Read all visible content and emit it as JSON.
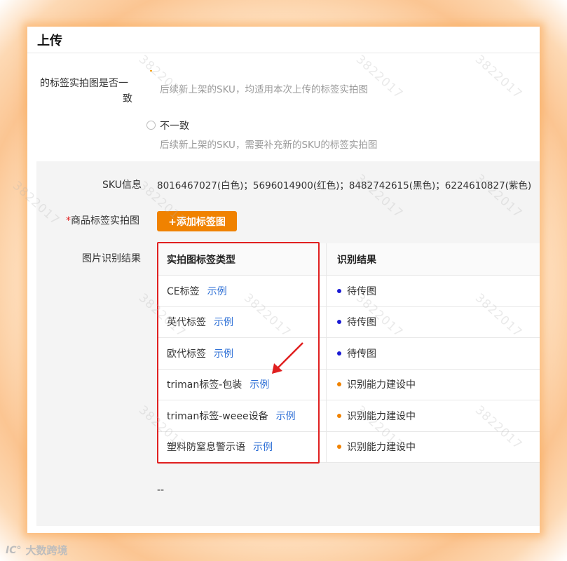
{
  "header": {
    "title": "上传"
  },
  "consistency": {
    "label_line1": "的标签实拍图是否一",
    "label_line2": "致",
    "consistent_hint": "后续新上架的SKU，均适用本次上传的标签实拍图",
    "inconsistent_label": "不一致",
    "inconsistent_hint": "后续新上架的SKU，需要补充新的SKU的标签实拍图"
  },
  "sku": {
    "label": "SKU信息",
    "value": "8016467027(白色)；5696014900(红色)；8482742615(黑色)；6224610827(紫色)"
  },
  "photo": {
    "required_mark": "*",
    "label": "商品标签实拍图",
    "add_button": "+添加标签图"
  },
  "recognition": {
    "label": "图片识别结果",
    "columns": [
      "实拍图标签类型",
      "识别结果"
    ],
    "rows": [
      {
        "type": "CE标签",
        "link": "示例",
        "result": "待传图",
        "status_color": "#1a1ad4"
      },
      {
        "type": "英代标签",
        "link": "示例",
        "result": "待传图",
        "status_color": "#1a1ad4"
      },
      {
        "type": "欧代标签",
        "link": "示例",
        "result": "待传图",
        "status_color": "#1a1ad4"
      },
      {
        "type": "triman标签-包装",
        "link": "示例",
        "result": "识别能力建设中",
        "status_color": "#f08200"
      },
      {
        "type": "triman标签-weee设备",
        "link": "示例",
        "result": "识别能力建设中",
        "status_color": "#f08200"
      },
      {
        "type": "塑料防窒息警示语",
        "link": "示例",
        "result": "识别能力建设中",
        "status_color": "#f08200"
      }
    ],
    "empty_value": "--"
  },
  "watermark_text": "3822017",
  "footer_logo": {
    "mark": "IC°",
    "text": "大数跨境"
  },
  "colors": {
    "accent": "#f08200",
    "link": "#2d6fd6",
    "highlight_box": "#e02020",
    "glow": "#fbc592"
  }
}
